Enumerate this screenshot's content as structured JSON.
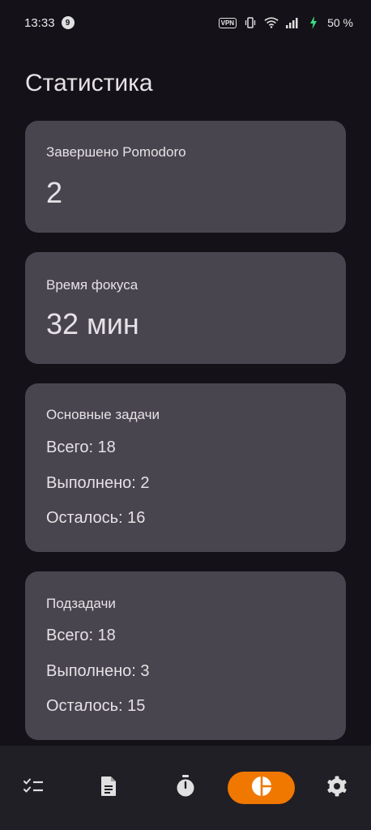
{
  "status_bar": {
    "time": "13:33",
    "notification_count": "9",
    "vpn_label": "VPN",
    "battery": "50 %"
  },
  "page": {
    "title": "Статистика"
  },
  "cards": {
    "pomodoro": {
      "title": "Завершено Pomodoro",
      "value": "2"
    },
    "focus": {
      "title": "Время фокуса",
      "value": "32 мин"
    },
    "main_tasks": {
      "title": "Основные задачи",
      "total": "Всего: 18",
      "done": "Выполнено: 2",
      "left": "Осталось: 16"
    },
    "subtasks": {
      "title": "Подзадачи",
      "total": "Всего: 18",
      "done": "Выполнено: 3",
      "left": "Осталось: 15"
    }
  },
  "bottom_nav": {
    "items": [
      {
        "icon": "checklist-icon"
      },
      {
        "icon": "document-icon"
      },
      {
        "icon": "timer-icon"
      },
      {
        "icon": "pie-chart-icon",
        "active": true
      },
      {
        "icon": "gear-icon"
      }
    ]
  },
  "colors": {
    "background": "#141218",
    "card": "#49454f",
    "nav_background": "#211f26",
    "accent": "#f07800",
    "text": "#e6e1e5"
  }
}
